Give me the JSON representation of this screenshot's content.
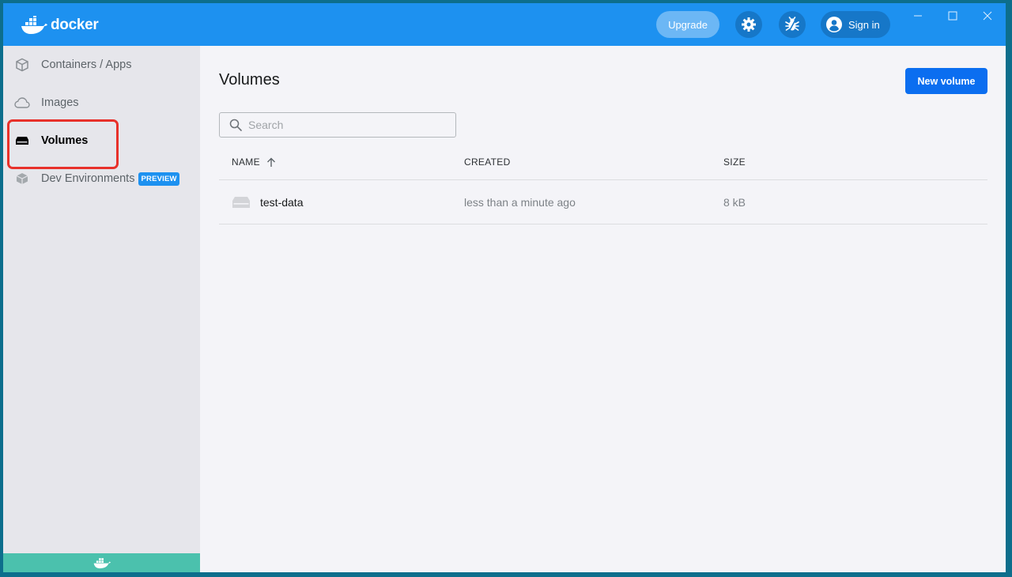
{
  "titlebar": {
    "logo_text": "docker",
    "upgrade_label": "Upgrade",
    "settings_icon": "gear-icon",
    "troubleshoot_icon": "bug-icon",
    "signin_label": "Sign in"
  },
  "sidebar": {
    "items": [
      {
        "label": "Containers / Apps",
        "icon": "containers-icon"
      },
      {
        "label": "Images",
        "icon": "cloud-icon"
      },
      {
        "label": "Volumes",
        "icon": "volume-icon",
        "active": true
      },
      {
        "label": "Dev Environments",
        "icon": "dev-environments-icon",
        "badge": "PREVIEW"
      }
    ]
  },
  "main": {
    "title": "Volumes",
    "new_volume_label": "New volume",
    "search_placeholder": "Search",
    "columns": [
      "NAME",
      "CREATED",
      "SIZE"
    ],
    "rows": [
      {
        "name": "test-data",
        "created": "less than a minute ago",
        "size": "8 kB"
      }
    ]
  },
  "colors": {
    "titlebar": "#1d91f0",
    "primary_button": "#0b6ef0",
    "status_bar": "#4bc1ad",
    "highlight": "#e8312a"
  }
}
